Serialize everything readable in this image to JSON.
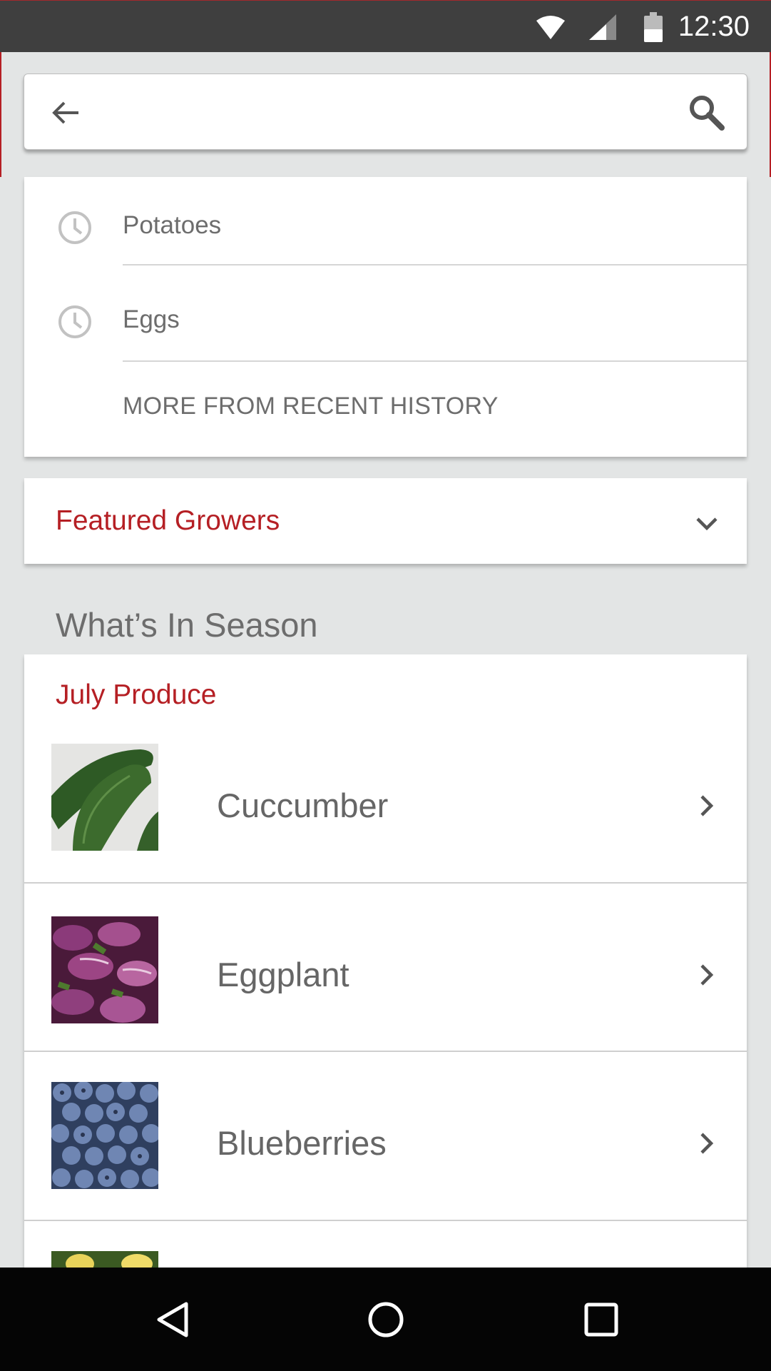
{
  "status_bar": {
    "time": "12:30",
    "icons": [
      "wifi-icon",
      "cell-signal-icon",
      "battery-icon"
    ],
    "background": "#3f3f3f"
  },
  "search": {
    "value": "",
    "placeholder": "",
    "back_icon": "arrow-left-icon",
    "search_icon": "search-icon"
  },
  "history": {
    "items": [
      {
        "label": "Potatoes",
        "icon": "clock-icon"
      },
      {
        "label": "Eggs",
        "icon": "clock-icon"
      }
    ],
    "more_label": "MORE FROM RECENT HISTORY"
  },
  "featured": {
    "title": "Featured Growers",
    "icon": "chevron-down-icon"
  },
  "season": {
    "heading": "What’s In Season",
    "card_title": "July  Produce",
    "items": [
      {
        "name": "Cuccumber",
        "image": "cucumber-image"
      },
      {
        "name": "Eggplant",
        "image": "eggplant-image"
      },
      {
        "name": "Blueberries",
        "image": "blueberries-image"
      },
      {
        "name": "",
        "image": "corn-image"
      }
    ]
  },
  "nav_bar": {
    "buttons": [
      "back-triangle-icon",
      "home-circle-icon",
      "recents-square-icon"
    ]
  },
  "colors": {
    "accent": "#b51f24",
    "background": "#e3e5e5",
    "text": "#6d6d6d"
  }
}
